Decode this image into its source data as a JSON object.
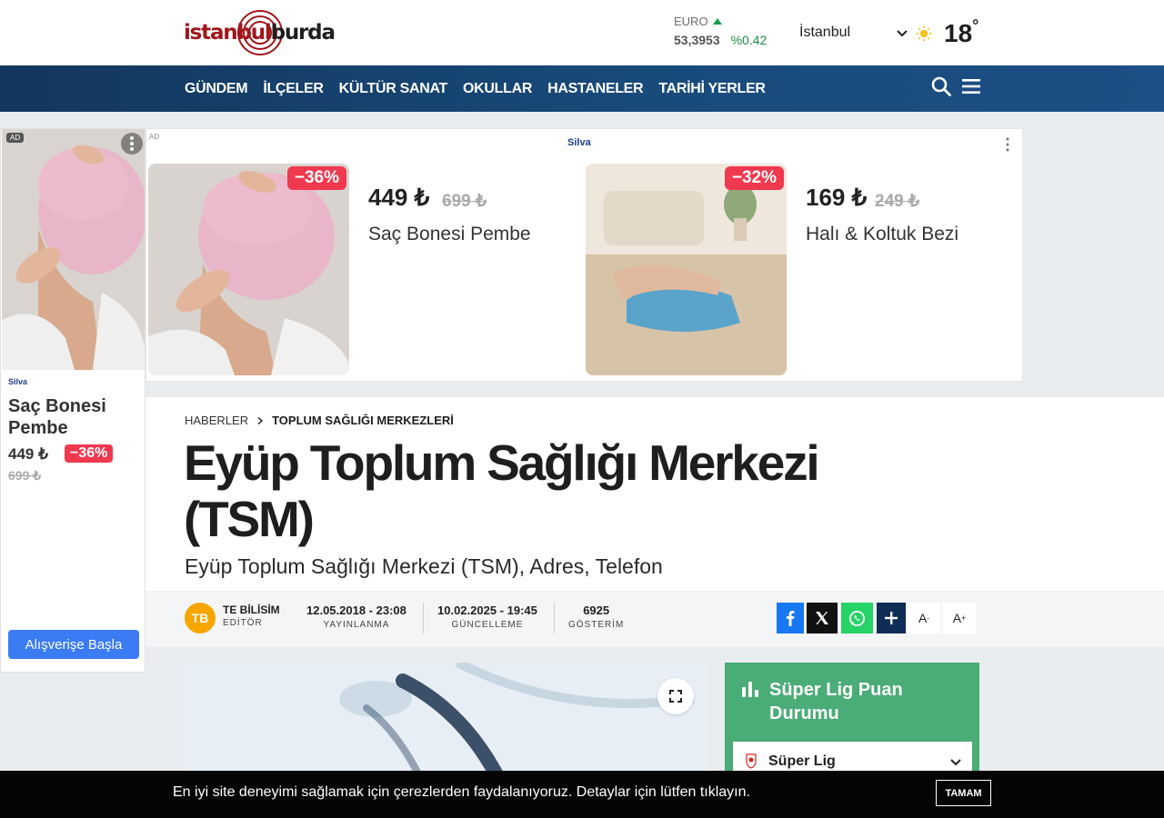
{
  "header": {
    "logo_part1": "istanbul",
    "logo_part2": "burda",
    "currency": {
      "name": "EURO",
      "value": "53,3953",
      "change": "%0.42",
      "trend": "up"
    },
    "city": "İstanbul",
    "weather_icon": "sun-icon",
    "temperature": "18",
    "degree": "°"
  },
  "nav": {
    "items": [
      "GÜNDEM",
      "İLÇELER",
      "KÜLTÜR SANAT",
      "OKULLAR",
      "HASTANELER",
      "TARİHİ YERLER"
    ]
  },
  "left_ad": {
    "badge": "AD",
    "brand": "Silva",
    "title": "Saç Bonesi Pembe",
    "price": "449 ₺",
    "old_price": "699 ₺",
    "discount": "−36%",
    "button": "Alışverişe Başla"
  },
  "top_ad": {
    "label": "AD",
    "brand": "Silva",
    "products": [
      {
        "discount": "−36%",
        "price": "449 ₺",
        "old_price": "699 ₺",
        "name": "Saç Bonesi Pembe"
      },
      {
        "discount": "−32%",
        "price": "169 ₺",
        "old_price": "249 ₺",
        "name": "Halı & Koltuk Bezi"
      }
    ]
  },
  "breadcrumb": {
    "home": "HABERLER",
    "category": "TOPLUM SAĞLIĞI MERKEZLERİ"
  },
  "article": {
    "title": "Eyüp Toplum Sağlığı Merkezi (TSM)",
    "subtitle": "Eyüp Toplum Sağlığı Merkezi (TSM), Adres, Telefon"
  },
  "meta": {
    "avatar_initials": "TB",
    "author": "TE BİLİSİM",
    "role": "EDİTÖR",
    "published": {
      "value": "12.05.2018 - 23:08",
      "label": "YAYINLANMA"
    },
    "updated": {
      "value": "10.02.2025 - 19:45",
      "label": "GÜNCELLEME"
    },
    "views": {
      "value": "6925",
      "label": "GÖSTERİM"
    },
    "font_smaller": "A",
    "font_larger": "A",
    "font_smaller_sup": "-",
    "font_larger_sup": "+"
  },
  "widget": {
    "title": "Süper Lig Puan Durumu",
    "league": "Süper Lig"
  },
  "cookie": {
    "text": "En iyi site deneyimi sağlamak için çerezlerden faydalanıyoruz. Detaylar için lütfen tıklayın.",
    "button": "TAMAM"
  },
  "colors": {
    "brand_red": "#a0161b",
    "nav_blue": "#184a7a",
    "discount_red": "#f0384e",
    "widget_green": "#4aac76",
    "cta_blue": "#3b7cf4"
  }
}
